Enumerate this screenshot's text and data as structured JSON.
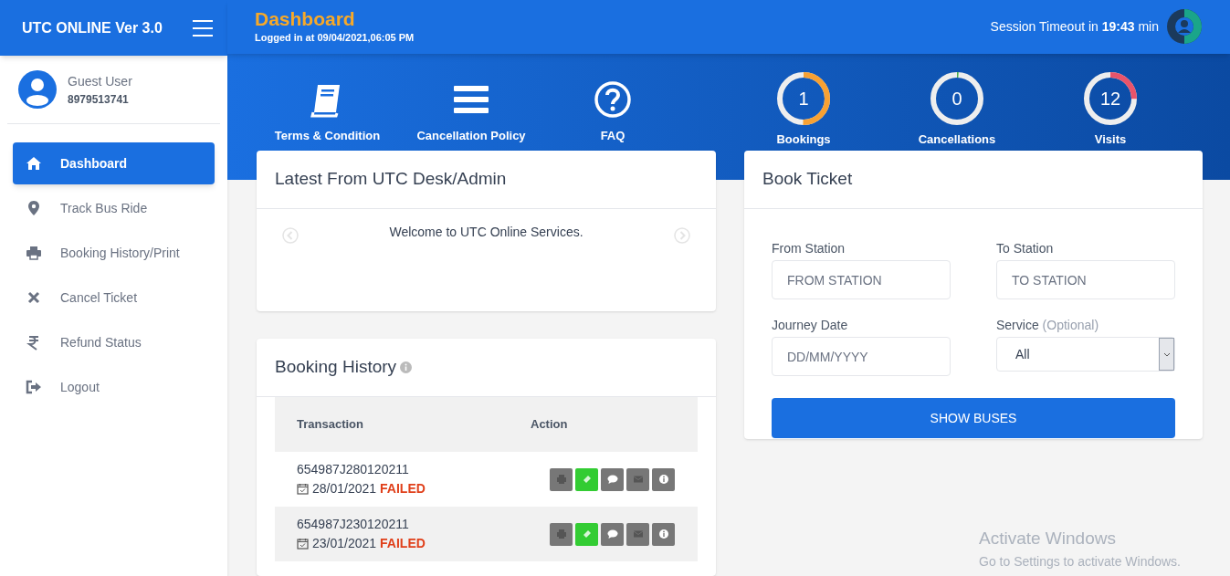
{
  "brand": "UTC ONLINE Ver 3.0",
  "header": {
    "title": "Dashboard",
    "logged_in": "Logged in at 09/04/2021,06:05 PM",
    "session": "Session Timeout in **19:43** min"
  },
  "user": {
    "name": "Guest User",
    "phone": "8979513741"
  },
  "sidebar": {
    "items": [
      {
        "label": "Dashboard",
        "kind": "home",
        "selected": true
      },
      {
        "label": "Track Bus Ride",
        "kind": "pin",
        "selected": false
      },
      {
        "label": "Booking History/Print",
        "kind": "print",
        "selected": false
      },
      {
        "label": "Cancel Ticket",
        "kind": "cross",
        "selected": false
      },
      {
        "label": "Refund Status",
        "kind": "rupee",
        "selected": false
      },
      {
        "label": "Logout",
        "kind": "logout",
        "selected": false
      }
    ]
  },
  "quick_links": [
    {
      "label": "Terms & Condition",
      "kind": "book"
    },
    {
      "label": "Cancellation Policy",
      "kind": "bars"
    },
    {
      "label": "FAQ",
      "kind": "question"
    }
  ],
  "stats": [
    {
      "label": "Bookings",
      "value": "1",
      "level": 0.5,
      "color": "#f7a133"
    },
    {
      "label": "Cancellations",
      "value": "0",
      "level": 0.01,
      "color": "#4caf50"
    },
    {
      "label": "Visits",
      "value": "12",
      "level": 0.25,
      "color": "#e9546b"
    }
  ],
  "news": {
    "title": "Latest From UTC Desk/Admin",
    "message": "Welcome to UTC Online Services."
  },
  "booking_history": {
    "title": "Booking History",
    "columns": [
      "Transaction",
      "Action"
    ],
    "rows": [
      {
        "id": "654987J280120211",
        "date": "28/01/2021",
        "status": "FAILED"
      },
      {
        "id": "654987J230120211",
        "date": "23/01/2021",
        "status": "FAILED"
      }
    ],
    "actions": [
      {
        "kind": "print"
      },
      {
        "kind": "ticket"
      },
      {
        "kind": "comment"
      },
      {
        "kind": "mail"
      },
      {
        "kind": "info"
      }
    ]
  },
  "book_ticket": {
    "title": "Book Ticket",
    "from": {
      "label": "From Station",
      "placeholder": "FROM STATION"
    },
    "to": {
      "label": "To Station",
      "placeholder": "TO STATION"
    },
    "date": {
      "label": "Journey Date",
      "placeholder": "DD/MM/YYYY"
    },
    "service": {
      "label": "Service",
      "hint": "(Optional)",
      "value": "All"
    },
    "button": "SHOW BUSES"
  },
  "os_notice": [
    "Activate Windows",
    "Go to Settings to activate Windows."
  ]
}
